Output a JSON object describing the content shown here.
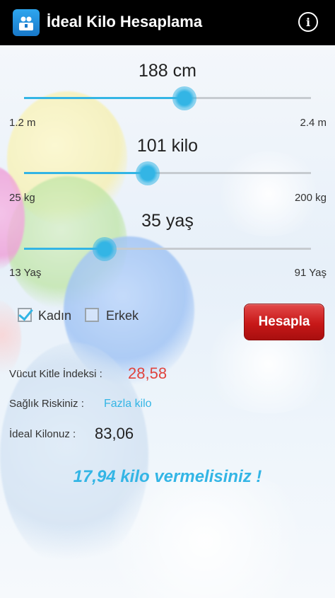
{
  "app": {
    "title": "İdeal Kilo Hesaplama",
    "info_glyph": "i",
    "icon": "app-logo-icon"
  },
  "colors": {
    "accent": "#33b5e5",
    "bmi_value": "#e0443e",
    "button": "#c71818",
    "message": "#33b5e5"
  },
  "height": {
    "value": "188 cm",
    "min": "1.2 m",
    "max": "2.4 m",
    "level": 0.56
  },
  "weight": {
    "value": "101 kilo",
    "min": "25 kg",
    "max": "200 kg",
    "level": 0.43
  },
  "age": {
    "value": "35 yaş",
    "min": "13 Yaş",
    "max": "91 Yaş",
    "level": 0.28
  },
  "gender": {
    "female_label": "Kadın",
    "female_checked": true,
    "male_label": "Erkek",
    "male_checked": false
  },
  "calculate_label": "Hesapla",
  "results": {
    "bmi_label": "Vücut Kitle İndeksi :",
    "bmi_value": "28,58",
    "risk_label": "Sağlık Riskiniz :",
    "risk_value": "Fazla kilo",
    "ideal_label": "İdeal Kilonuz :",
    "ideal_value": "83,06"
  },
  "message": "17,94 kilo vermelisiniz !"
}
